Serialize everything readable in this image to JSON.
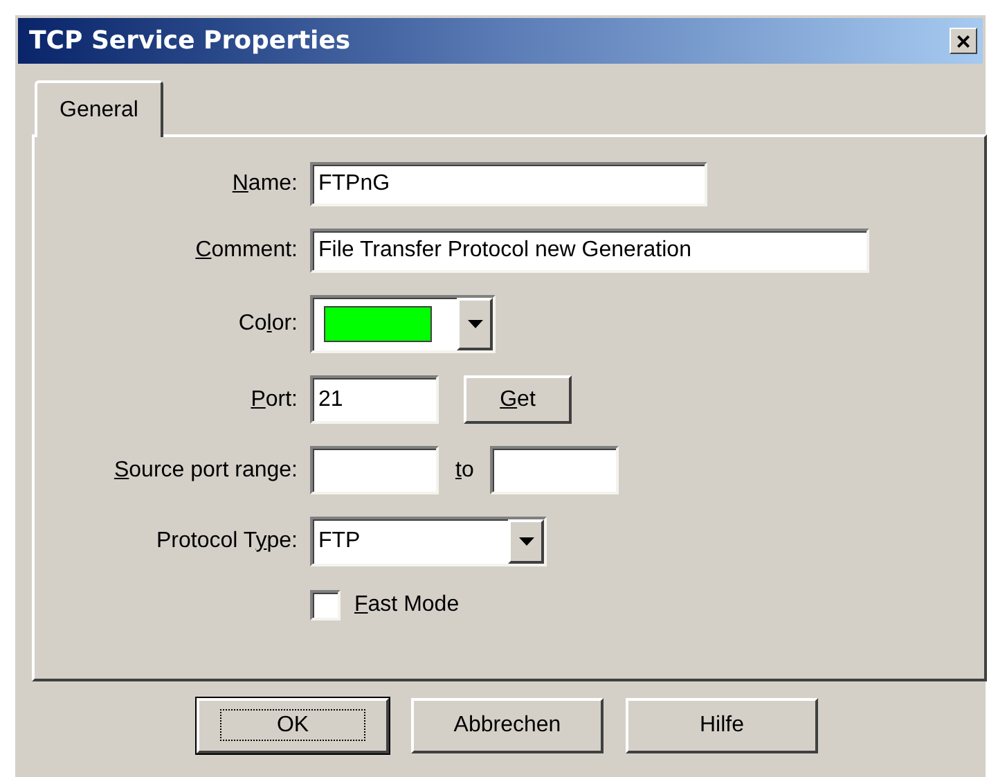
{
  "window": {
    "title": "TCP Service Properties",
    "close": "×"
  },
  "tabs": [
    {
      "label": "General",
      "selected": true
    }
  ],
  "fields": [
    {
      "kind": "text",
      "label": {
        "key": "N",
        "after": "ame:"
      },
      "value": "FTPnG"
    },
    {
      "kind": "long_text",
      "label": {
        "key": "C",
        "after": "omment:"
      },
      "value": "File Transfer Protocol new Generation"
    },
    {
      "kind": "color",
      "label": {
        "before": "Co",
        "key": "l",
        "after": "or:"
      },
      "color": "#00ff00"
    },
    {
      "kind": "port",
      "label": {
        "key": "P",
        "after": "ort:"
      },
      "value": "21",
      "button": {
        "key": "G",
        "after": "et"
      }
    },
    {
      "kind": "range",
      "label": {
        "key": "S",
        "after": "ource port range:"
      },
      "separator": {
        "key": "t",
        "after": "o"
      }
    },
    {
      "kind": "select",
      "label": {
        "before": "Protocol T",
        "key": "y",
        "after": "pe:"
      },
      "value": "FTP"
    },
    {
      "kind": "checkbox",
      "label": {
        "key": "F",
        "after": "ast Mode"
      },
      "checked": false
    }
  ],
  "buttons": [
    {
      "label": "OK",
      "default": true
    },
    {
      "label": "Abbrechen",
      "default": false
    },
    {
      "label": "Hilfe",
      "default": false
    }
  ]
}
